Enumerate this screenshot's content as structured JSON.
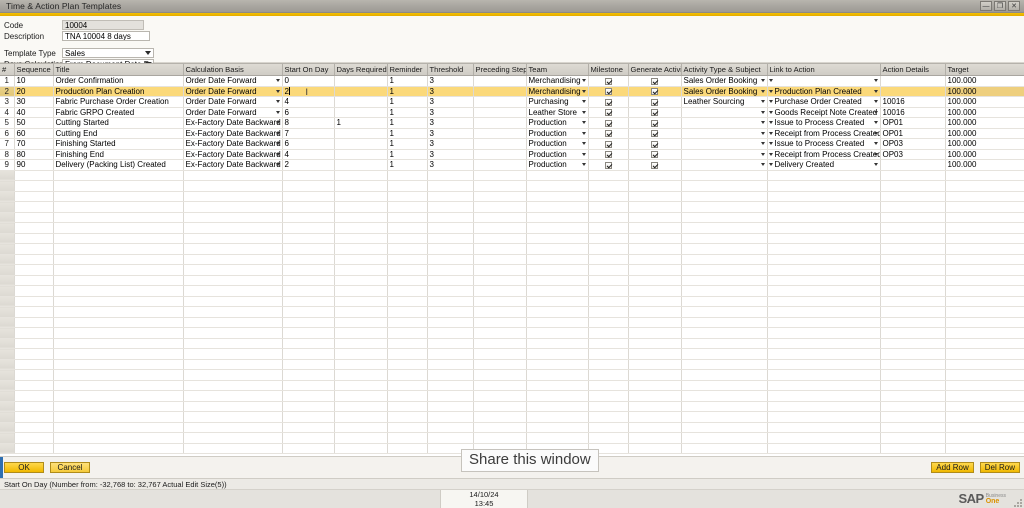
{
  "window": {
    "title": "Time & Action Plan Templates",
    "controls": [
      {
        "name": "minimize",
        "glyph": "—"
      },
      {
        "name": "restore",
        "glyph": "❐"
      },
      {
        "name": "close",
        "glyph": "✕"
      }
    ]
  },
  "form": {
    "code_label": "Code",
    "code_value": "10004",
    "description_label": "Description",
    "description_value": "TNA 10004 8 days",
    "template_type_label": "Template Type",
    "template_type_value": "Sales",
    "days_calculation_label": "Days Calculation",
    "days_calculation_value": "From Document Date Forw"
  },
  "grid": {
    "columns": [
      "#",
      "Sequence",
      "Title",
      "Calculation Basis",
      "Start On Day",
      "Days Required",
      "Reminder",
      "Threshold",
      "Preceding Step",
      "Team",
      "Milestone",
      "Generate Activity",
      "Activity Type & Subject",
      "Link to Action",
      "Action Details",
      "Target"
    ],
    "rows": [
      {
        "num": "1",
        "sequence": "10",
        "title": "Order Confirmation",
        "calculation_basis": "Order Date Forward",
        "start_on_day": "0",
        "days_required": "",
        "reminder": "1",
        "threshold": "3",
        "preceding_step": "",
        "team": "Merchandising",
        "milestone": true,
        "generate_activity": true,
        "activity_type": "Sales Order Booking",
        "link_to_action": "",
        "action_details": "",
        "target": "100.000",
        "selected": false
      },
      {
        "num": "2",
        "sequence": "20",
        "title": "Production Plan Creation",
        "calculation_basis": "Order Date Forward",
        "start_on_day": "2",
        "days_required": "",
        "reminder": "1",
        "threshold": "3",
        "preceding_step": "",
        "team": "Merchandising",
        "milestone": true,
        "generate_activity": true,
        "activity_type": "Sales Order Booking",
        "link_to_action": "Production Plan Created",
        "action_details": "",
        "target": "100.000",
        "selected": true
      },
      {
        "num": "3",
        "sequence": "30",
        "title": "Fabric Purchase Order Creation",
        "calculation_basis": "Order Date Forward",
        "start_on_day": "4",
        "days_required": "",
        "reminder": "1",
        "threshold": "3",
        "preceding_step": "",
        "team": "Purchasing",
        "milestone": true,
        "generate_activity": true,
        "activity_type": "Leather Sourcing",
        "link_to_action": "Purchase Order Created",
        "action_details": "10016",
        "target": "100.000",
        "selected": false
      },
      {
        "num": "4",
        "sequence": "40",
        "title": "Fabric GRPO Created",
        "calculation_basis": "Order Date Forward",
        "start_on_day": "6",
        "days_required": "",
        "reminder": "1",
        "threshold": "3",
        "preceding_step": "",
        "team": "Leather Store",
        "milestone": true,
        "generate_activity": true,
        "activity_type": "",
        "link_to_action": "Goods Receipt Note Created",
        "action_details": "10016",
        "target": "100.000",
        "selected": false
      },
      {
        "num": "5",
        "sequence": "50",
        "title": "Cutting Started",
        "calculation_basis": "Ex-Factory Date Backward",
        "start_on_day": "8",
        "days_required": "1",
        "reminder": "1",
        "threshold": "3",
        "preceding_step": "",
        "team": "Production",
        "milestone": true,
        "generate_activity": true,
        "activity_type": "",
        "link_to_action": "Issue to Process Created",
        "action_details": "OP01",
        "target": "100.000",
        "selected": false
      },
      {
        "num": "6",
        "sequence": "60",
        "title": "Cutting End",
        "calculation_basis": "Ex-Factory Date Backward",
        "start_on_day": "7",
        "days_required": "",
        "reminder": "1",
        "threshold": "3",
        "preceding_step": "",
        "team": "Production",
        "milestone": true,
        "generate_activity": true,
        "activity_type": "",
        "link_to_action": "Receipt from Process Created",
        "action_details": "OP01",
        "target": "100.000",
        "selected": false
      },
      {
        "num": "7",
        "sequence": "70",
        "title": "Finishing Started",
        "calculation_basis": "Ex-Factory Date Backward",
        "start_on_day": "6",
        "days_required": "",
        "reminder": "1",
        "threshold": "3",
        "preceding_step": "",
        "team": "Production",
        "milestone": true,
        "generate_activity": true,
        "activity_type": "",
        "link_to_action": "Issue to Process Created",
        "action_details": "OP03",
        "target": "100.000",
        "selected": false
      },
      {
        "num": "8",
        "sequence": "80",
        "title": "Finishing End",
        "calculation_basis": "Ex-Factory Date Backward",
        "start_on_day": "4",
        "days_required": "",
        "reminder": "1",
        "threshold": "3",
        "preceding_step": "",
        "team": "Production",
        "milestone": true,
        "generate_activity": true,
        "activity_type": "",
        "link_to_action": "Receipt from Process Created",
        "action_details": "OP03",
        "target": "100.000",
        "selected": false
      },
      {
        "num": "9",
        "sequence": "90",
        "title": "Delivery (Packing List) Created",
        "calculation_basis": "Ex-Factory Date Backward",
        "start_on_day": "2",
        "days_required": "",
        "reminder": "1",
        "threshold": "3",
        "preceding_step": "",
        "team": "Production",
        "milestone": true,
        "generate_activity": true,
        "activity_type": "",
        "link_to_action": "Delivery Created",
        "action_details": "",
        "target": "100.000",
        "selected": false
      }
    ]
  },
  "footer": {
    "ok_label": "OK",
    "cancel_label": "Cancel",
    "add_row_label": "Add Row",
    "del_row_label": "Del Row",
    "share_overlay": "Share this window"
  },
  "status": {
    "message": "Start On Day (Number from: -32,768 to: 32,767 Actual Edit Size(5))",
    "date": "14/10/24",
    "time": "13:45",
    "logo_main": "SAP",
    "logo_sub_top": "Business",
    "logo_sub_bottom": "One"
  },
  "colors": {
    "accent": "#f5c000",
    "selected_row": "#fbd97a",
    "title_bar": "#a9a6a0",
    "sap_orange": "#d99100"
  }
}
